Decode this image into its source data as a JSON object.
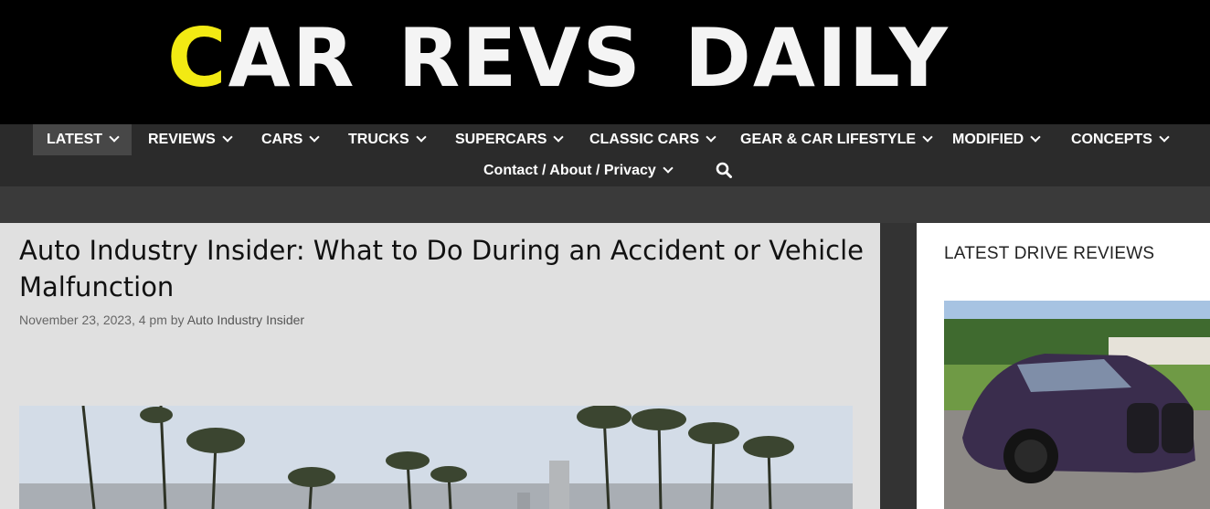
{
  "site": {
    "logo_initial": "C",
    "logo_rest": "AR_REVS_DAILY",
    "accent": "#f2ea13"
  },
  "nav": {
    "items": [
      {
        "label": "LATEST"
      },
      {
        "label": "REVIEWS"
      },
      {
        "label": "CARS"
      },
      {
        "label": "TRUCKS"
      },
      {
        "label": "SUPERCARS"
      },
      {
        "label": "CLASSIC CARS"
      },
      {
        "label": "GEAR & CAR LIFESTYLE"
      },
      {
        "label": "MODIFIED"
      },
      {
        "label": "CONCEPTS"
      },
      {
        "label": "Contact / About / Privacy"
      }
    ],
    "active": "LATEST",
    "search_icon": "search-icon"
  },
  "article": {
    "title": "Auto Industry Insider: What to Do During an Accident or Vehicle Malfunction",
    "date": "November 23, 2023, 4 pm",
    "by": "by",
    "author": "Auto Industry Insider"
  },
  "sidebar": {
    "title": "LATEST DRIVE REVIEWS"
  }
}
